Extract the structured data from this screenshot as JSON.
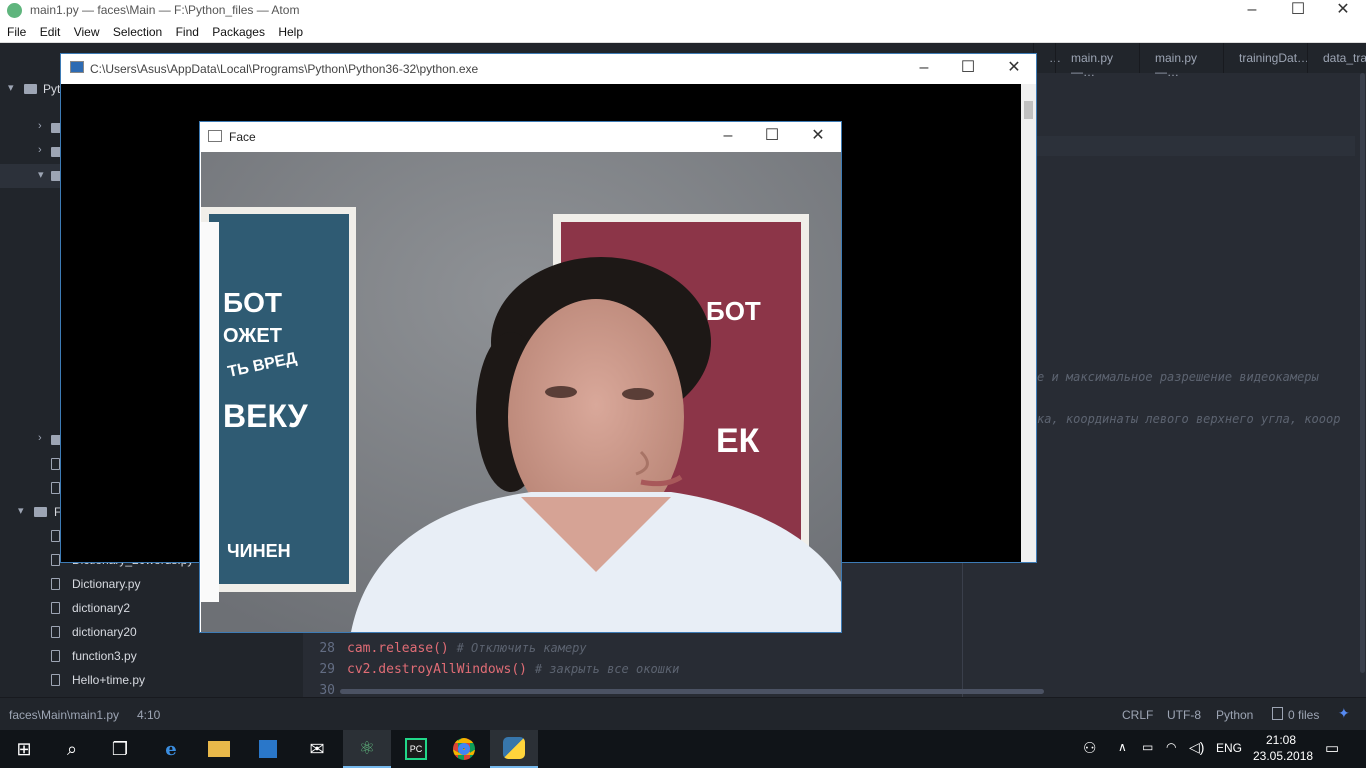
{
  "atom": {
    "window_title": "main1.py — faces\\Main — F:\\Python_files — Atom",
    "menu": [
      "File",
      "Edit",
      "View",
      "Selection",
      "Find",
      "Packages",
      "Help"
    ],
    "tabs": [
      "…",
      "main.py —…",
      "main.py —…",
      "trainingDat…",
      "data_tra"
    ],
    "tree_items": [
      {
        "label": "Pyt",
        "kind": "folder-root"
      },
      {
        "label": "Dictionary_20words.py",
        "kind": "file"
      },
      {
        "label": "Dictionary.py",
        "kind": "file"
      },
      {
        "label": "dictionary2",
        "kind": "file"
      },
      {
        "label": "dictionary20",
        "kind": "file"
      },
      {
        "label": "function3.py",
        "kind": "file"
      },
      {
        "label": "Hello+time.py",
        "kind": "file"
      },
      {
        "label": "F",
        "kind": "folder"
      }
    ],
    "visible_comments": [
      "е и максимальное разрешение видеокамеры",
      "ка, координаты левого верхнего угла, кооор"
    ],
    "code_lines": [
      {
        "num": "28",
        "code": "cam.release()",
        "comment": "# Отключить камеру"
      },
      {
        "num": "29",
        "code": "cv2.destroyAllWindows()",
        "comment": "# закрыть все окошки"
      },
      {
        "num": "30",
        "code": "",
        "comment": ""
      }
    ],
    "status": {
      "path": "faces\\Main\\main1.py",
      "cursor": "4:10",
      "line_ending": "CRLF",
      "encoding": "UTF-8",
      "grammar": "Python",
      "files": "0 files"
    }
  },
  "console_window": {
    "title": "C:\\Users\\Asus\\AppData\\Local\\Programs\\Python\\Python36-32\\python.exe"
  },
  "face_window": {
    "title": "Face",
    "poster_left_lines": [
      "БОТ",
      "ОЖЕТ",
      "ТЬ ВРЕД",
      "ВЕКУ",
      "ЧИНЕН"
    ],
    "poster_right_lines": [
      "БОТ",
      "ЕК"
    ]
  },
  "caption_buttons": {
    "minimize": "–",
    "maximize": "☐",
    "close": "✕"
  },
  "taskbar": {
    "language": "ENG",
    "time": "21:08",
    "date": "23.05.2018"
  },
  "colors": {
    "atom_bg": "#282c34",
    "tree_bg": "#21252b",
    "window_border": "#3d7bb5",
    "taskbar": "#101418"
  }
}
